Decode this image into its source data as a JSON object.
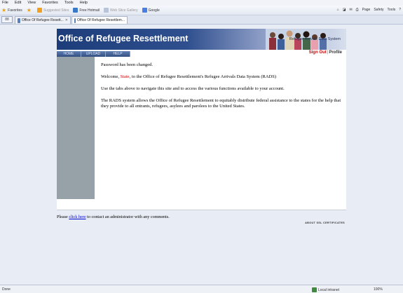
{
  "browser": {
    "menu": [
      "File",
      "Edit",
      "View",
      "Favorites",
      "Tools",
      "Help"
    ],
    "favorites_label": "Favorites",
    "favorites_bar": [
      {
        "label": "Suggested Sites",
        "dim": true
      },
      {
        "label": "Free Hotmail",
        "dim": false
      },
      {
        "label": "Web Slice Gallery",
        "dim": true
      },
      {
        "label": "Google",
        "dim": false
      }
    ],
    "command_bar": [
      "Page",
      "Safety",
      "Tools"
    ],
    "tabs": [
      {
        "label": "Office Of Refugee Resett...",
        "active": false
      },
      {
        "label": "Office Of Refugee Resettlem...",
        "active": true
      }
    ],
    "tab_grid_label": "88",
    "status": {
      "left": "Done",
      "zone": "Local intranet",
      "zoom": "100%"
    }
  },
  "site": {
    "title": "Office of Refugee Resettlement",
    "system_name": "Refugee Arrivals Data System",
    "sign_out": "Sign Out",
    "separator": "|",
    "profile": "Profile",
    "nav": [
      "HOME",
      "UPLOAD",
      "HELP"
    ]
  },
  "content": {
    "confirmation": "Password has been changed.",
    "welcome_pre": "Welcome, ",
    "welcome_name": "State",
    "welcome_post": ", to the Office of Refugee Resettlement's Refugee Arrivals Data System (RADS)",
    "instructions": "Use the tabs above to navigate this site and to access the various functions available to your account.",
    "about": "The RADS system allows the Office of Refugee Resettlement to equitably distribute federal assistance to the states for the help that they provide to all entrants, refugees, asylees and parolees to the United States."
  },
  "footer": {
    "pre": "Please ",
    "link": "click here",
    "post": " to contact an administrator with any comments.",
    "certificates": "ABOUT SSL CERTIFICATES"
  },
  "colors": {
    "banner": "#1d3c7a",
    "sign_out": "#cc0000",
    "sidebar": "#96a1a8",
    "link": "#0000cc"
  }
}
